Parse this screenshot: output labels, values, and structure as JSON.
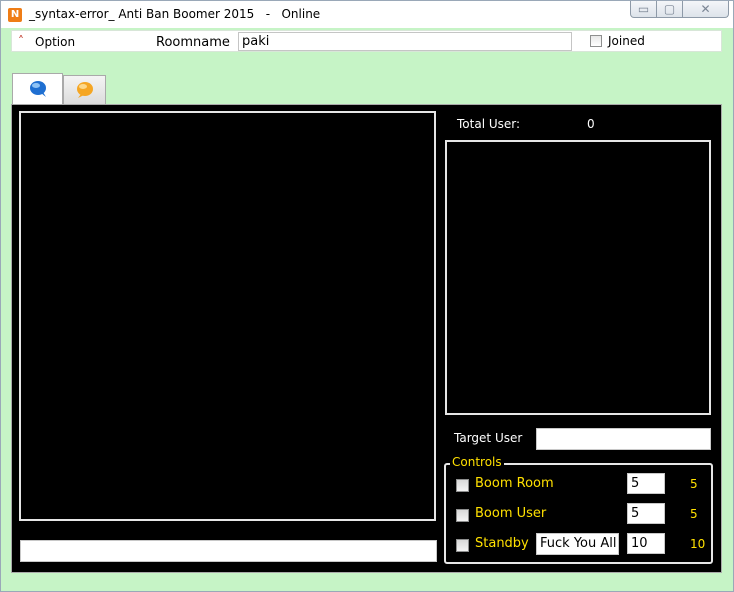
{
  "window": {
    "app_icon_letter": "N",
    "title": "_syntax-error_ Anti Ban Boomer 2015   -   Online",
    "minimize_glyph": "▭",
    "maximize_glyph": "▢",
    "close_glyph": "✕"
  },
  "menubar": {
    "option_label": "Option",
    "roomname_label": "Roomname",
    "roomname_value": "paki",
    "joined_label": "Joined"
  },
  "tabs": [
    {
      "icon": "blue-chat-bubble-icon",
      "color": "#1f6fd1"
    },
    {
      "icon": "orange-chat-bubble-icon",
      "color": "#f5a623"
    }
  ],
  "users": {
    "total_label": "Total User:",
    "total_count": "0"
  },
  "target": {
    "label": "Target User",
    "value": ""
  },
  "controls": {
    "legend": "Controls",
    "rows": [
      {
        "label": "Boom Room",
        "input": "5",
        "value": "5"
      },
      {
        "label": "Boom User",
        "input": "5",
        "value": "5"
      },
      {
        "label": "Standby",
        "message": "Fuck You All",
        "input": "10",
        "value": "10"
      }
    ]
  },
  "colors": {
    "background": "#c6f4c6",
    "panel": "#000000",
    "accent_text": "#ffe000"
  }
}
